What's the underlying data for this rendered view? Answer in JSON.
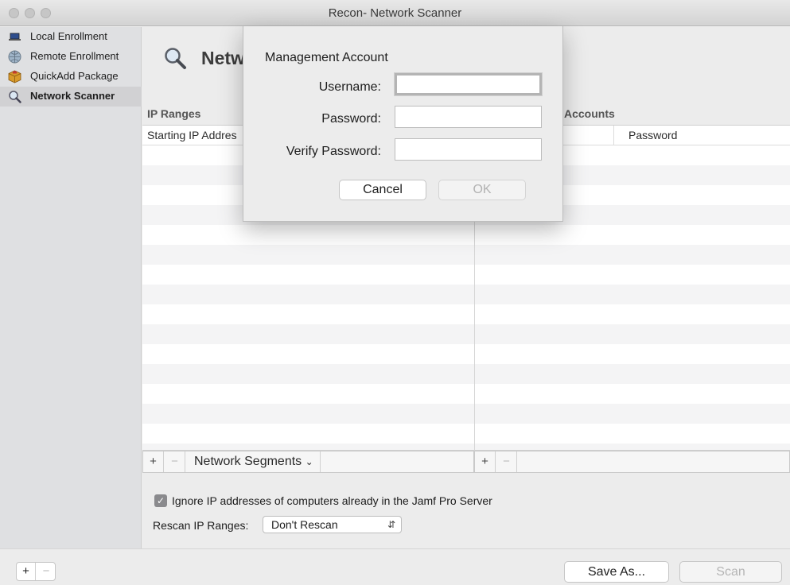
{
  "window": {
    "title": "Recon- Network Scanner"
  },
  "sidebar": {
    "items": [
      {
        "label": "Local Enrollment",
        "icon": "laptop-icon"
      },
      {
        "label": "Remote Enrollment",
        "icon": "globe-icon"
      },
      {
        "label": "QuickAdd Package",
        "icon": "package-icon"
      },
      {
        "label": "Network Scanner",
        "icon": "magnifier-icon",
        "selected": true
      }
    ]
  },
  "main": {
    "page_title": "Netwo",
    "ip_ranges": {
      "section_label": "IP Ranges",
      "columns": [
        "Starting IP Addres"
      ],
      "segments_label": "Network Segments"
    },
    "accounts": {
      "section_label": "Accounts",
      "columns": [
        "Password"
      ]
    },
    "ignore_checkbox": {
      "label": "Ignore IP addresses of computers already in the Jamf Pro Server",
      "checked": true
    },
    "rescan": {
      "label": "Rescan IP Ranges:",
      "value": "Don't Rescan"
    }
  },
  "footer": {
    "add": "+",
    "remove": "−",
    "save_as": "Save As...",
    "scan": "Scan"
  },
  "table_footer": {
    "add": "+",
    "remove": "−"
  },
  "dialog": {
    "title": "Management Account",
    "username_label": "Username:",
    "password_label": "Password:",
    "verify_label": "Verify Password:",
    "username_value": "",
    "password_value": "",
    "verify_value": "",
    "cancel": "Cancel",
    "ok": "OK"
  },
  "colors": {
    "sidebar_bg": "#dfe0e2",
    "window_bg": "#ececec",
    "row_alt": "#f4f4f5"
  }
}
